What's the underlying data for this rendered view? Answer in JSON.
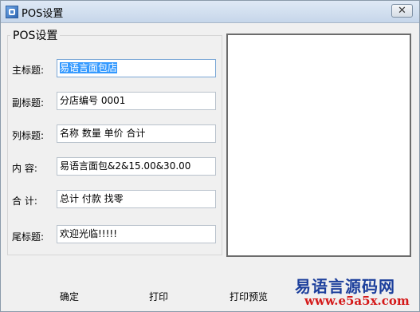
{
  "window": {
    "title": "POS设置",
    "close_glyph": "✕"
  },
  "group": {
    "title": "POS设置"
  },
  "fields": [
    {
      "label": "主标题:",
      "value": "易语言面包店"
    },
    {
      "label": "副标题:",
      "value": "分店编号 0001"
    },
    {
      "label": "列标题:",
      "value": "名称 数量 单价 合计"
    },
    {
      "label": "内 容:",
      "value": "易语言面包&2&15.00&30.00"
    },
    {
      "label": "合 计:",
      "value": "总计 付款 找零"
    },
    {
      "label": "尾标题:",
      "value": "欢迎光临!!!!!"
    }
  ],
  "buttons": {
    "ok": "确定",
    "print": "打印",
    "preview": "打印预览"
  },
  "watermark": {
    "line1": "易语言源码网",
    "line2": "www.e5a5x.com"
  }
}
